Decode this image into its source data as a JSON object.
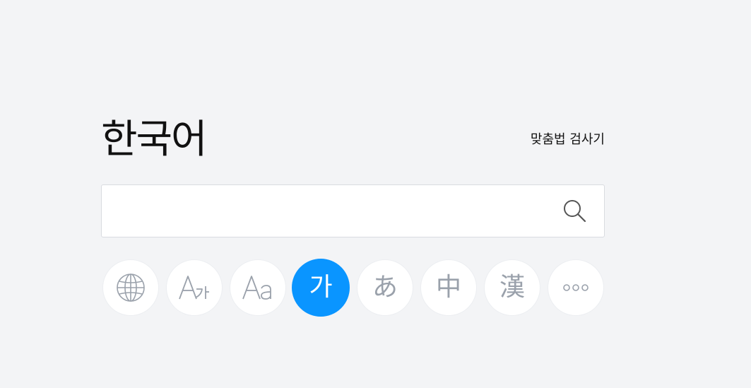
{
  "header": {
    "title": "한국어",
    "spell_checker_label": "맞춤법 검사기"
  },
  "search": {
    "value": "",
    "placeholder": ""
  },
  "languages": [
    {
      "icon": "globe-icon"
    },
    {
      "icon": "english-korean-icon"
    },
    {
      "icon": "english-icon"
    },
    {
      "label": "가",
      "active": true
    },
    {
      "label": "あ"
    },
    {
      "label": "中"
    },
    {
      "label": "漢"
    },
    {
      "icon": "more-icon"
    }
  ],
  "colors": {
    "background": "#f3f4f6",
    "accent": "#0a95ff",
    "icon_gray": "#9aa1ab"
  }
}
